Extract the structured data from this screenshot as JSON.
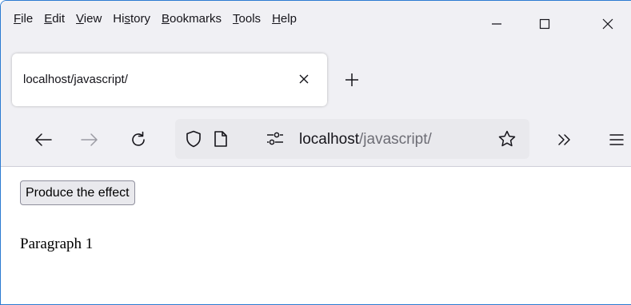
{
  "menu": {
    "items": [
      {
        "pre": "",
        "ul": "F",
        "post": "ile"
      },
      {
        "pre": "",
        "ul": "E",
        "post": "dit"
      },
      {
        "pre": "",
        "ul": "V",
        "post": "iew"
      },
      {
        "pre": "Hi",
        "ul": "s",
        "post": "tory"
      },
      {
        "pre": "",
        "ul": "B",
        "post": "ookmarks"
      },
      {
        "pre": "",
        "ul": "T",
        "post": "ools"
      },
      {
        "pre": "",
        "ul": "H",
        "post": "elp"
      }
    ]
  },
  "tab": {
    "title": "localhost/javascript/"
  },
  "url": {
    "host": "localhost",
    "path": "/javascript/"
  },
  "page": {
    "button_label": "Produce the effect",
    "paragraph": "Paragraph 1"
  },
  "colors": {
    "chrome_bg": "#f0f0f4",
    "urlbar_bg": "#e9e9ed",
    "window_border": "#2b7bd1"
  }
}
